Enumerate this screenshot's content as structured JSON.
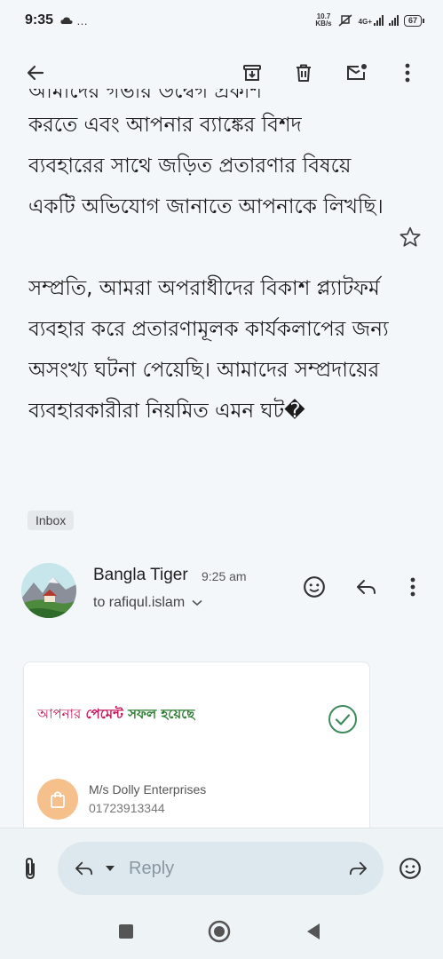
{
  "status_bar": {
    "time": "9:35",
    "extra_icons": "…",
    "net_speed_value": "10.7",
    "net_speed_unit": "KB/s",
    "network_type": "4G+",
    "battery": "67"
  },
  "toolbar": {
    "back_icon": "arrow-left-icon",
    "archive_icon": "archive-icon",
    "delete_icon": "trash-icon",
    "mark_unread_icon": "mark-unread-icon",
    "more_icon": "more-vert-icon"
  },
  "message": {
    "clipped_line": "আমাদের গভীর উদ্বেগ প্রকাশ",
    "paragraph_1": "করতে এবং আপনার ব্যাঙ্কের বিশদ ব্যবহারের সাথে জড়িত প্রতারণার বিষয়ে একটি অভিযোগ জানাতে আপনাকে লিখছি।",
    "paragraph_2": "সম্প্রতি, আমরা অপরাধীদের বিকাশ প্ল্যাটফর্ম ব্যবহার করে প্রতারণামূলক কার্যকলাপের জন্য অসংখ্য ঘটনা পেয়েছি। আমাদের সম্প্রদায়ের ব্যবহারকারীরা নিয়মিত এমন ঘট�",
    "label_chip": "Inbox"
  },
  "sender": {
    "name": "Bangla Tiger",
    "time": "9:25 am",
    "to": "to rafiqul.islam"
  },
  "card": {
    "pay_part_1": "আপনার",
    "pay_part_2": "পেমেন্ট",
    "pay_part_3": "সফল হয়েছে",
    "merchant_name": "M/s Dolly Enterprises",
    "merchant_phone": "01723913344"
  },
  "reply_bar": {
    "placeholder": "Reply"
  },
  "colors": {
    "background": "#f3f7fa",
    "accent_pink": "#c2185b",
    "accent_green": "#2e7d32",
    "success_check": "#3d8a5a",
    "merchant_icon_bg": "#f6c08c"
  }
}
